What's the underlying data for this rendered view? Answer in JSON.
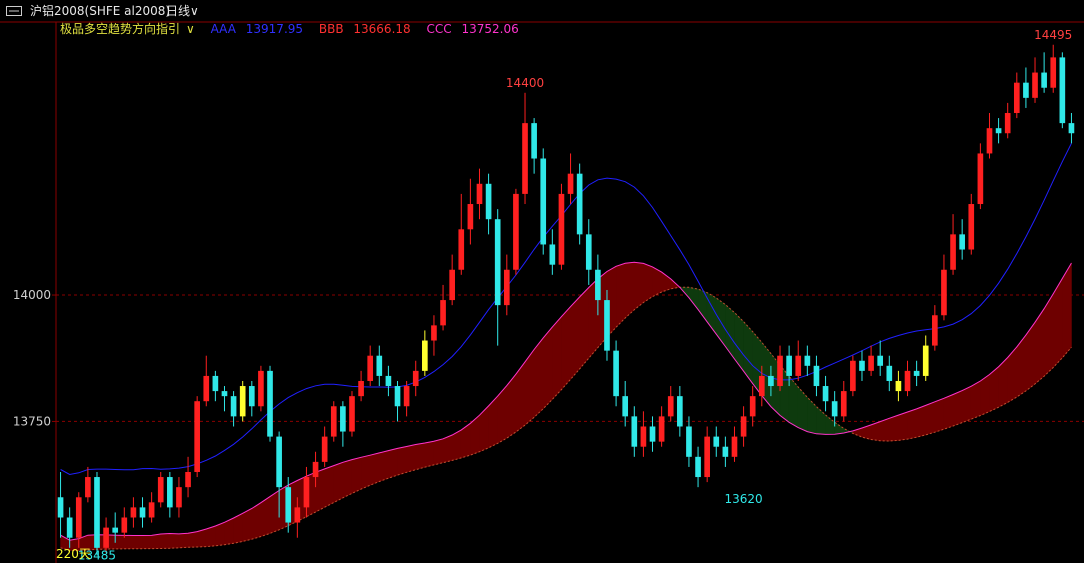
{
  "header": {
    "title": "沪铝2008(SHFE al2008)",
    "period": "日线",
    "period_caret": "∨"
  },
  "legend": {
    "indicator": "极品多空趋势方向指引",
    "caret": "∨",
    "items": [
      {
        "label": "AAA",
        "value": "13917.95",
        "color": "#2020ff"
      },
      {
        "label": "BBB",
        "value": "13666.18",
        "color": "#ff3030"
      },
      {
        "label": "CCC",
        "value": "13752.06",
        "color": "#ff33cc"
      }
    ]
  },
  "colors": {
    "up": "#ff2020",
    "down": "#30e8e8",
    "signal": "#ffff30",
    "aaa_line": "#2020ff",
    "ccc_line": "#ff33cc",
    "bull_band": "#6e0000",
    "bear_band": "#0e3a0e",
    "grid": "#8a0000",
    "axis": "#8a0000"
  },
  "chart_data": {
    "type": "candlestick",
    "ylim": [
      13470,
      14540
    ],
    "yticks": [
      {
        "value": 14000,
        "label": "14000"
      },
      {
        "value": 13750,
        "label": "13750"
      }
    ],
    "annotations": [
      {
        "text": "14400",
        "value": 14400,
        "index": 51,
        "color": "#ff4040"
      },
      {
        "text": "13620",
        "value": 13620,
        "index": 75,
        "color": "#30e8e8"
      },
      {
        "text": "14495",
        "value": 14495,
        "index": 109,
        "color": "#ff4040"
      },
      {
        "text": "13485",
        "value": 13485,
        "index": 4,
        "color": "#30e8e8"
      },
      {
        "text": "220天",
        "value": 13480,
        "index": 0,
        "color": "#ffff30"
      }
    ],
    "candles": [
      [
        13600,
        13560,
        13650,
        13520
      ],
      [
        13560,
        13520,
        13580,
        13500
      ],
      [
        13520,
        13600,
        13610,
        13500
      ],
      [
        13600,
        13640,
        13660,
        13590
      ],
      [
        13640,
        13500,
        13650,
        13485
      ],
      [
        13500,
        13540,
        13560,
        13490
      ],
      [
        13540,
        13530,
        13570,
        13510
      ],
      [
        13530,
        13560,
        13580,
        13520
      ],
      [
        13560,
        13580,
        13600,
        13540
      ],
      [
        13580,
        13560,
        13600,
        13540
      ],
      [
        13560,
        13590,
        13610,
        13550
      ],
      [
        13590,
        13640,
        13650,
        13580
      ],
      [
        13640,
        13580,
        13650,
        13560
      ],
      [
        13580,
        13620,
        13640,
        13560
      ],
      [
        13620,
        13650,
        13680,
        13600
      ],
      [
        13650,
        13790,
        13800,
        13640
      ],
      [
        13790,
        13840,
        13880,
        13780
      ],
      [
        13840,
        13810,
        13850,
        13790
      ],
      [
        13810,
        13800,
        13820,
        13770
      ],
      [
        13800,
        13760,
        13810,
        13740
      ],
      [
        13760,
        13820,
        13830,
        13750
      ],
      [
        13820,
        13780,
        13830,
        13760
      ],
      [
        13780,
        13850,
        13860,
        13770
      ],
      [
        13850,
        13720,
        13860,
        13710
      ],
      [
        13720,
        13620,
        13730,
        13560
      ],
      [
        13620,
        13550,
        13640,
        13530
      ],
      [
        13550,
        13580,
        13600,
        13520
      ],
      [
        13580,
        13640,
        13660,
        13560
      ],
      [
        13640,
        13670,
        13690,
        13620
      ],
      [
        13670,
        13720,
        13740,
        13660
      ],
      [
        13720,
        13780,
        13790,
        13710
      ],
      [
        13780,
        13730,
        13790,
        13700
      ],
      [
        13730,
        13800,
        13810,
        13720
      ],
      [
        13800,
        13830,
        13850,
        13790
      ],
      [
        13830,
        13880,
        13900,
        13820
      ],
      [
        13880,
        13840,
        13900,
        13820
      ],
      [
        13840,
        13820,
        13860,
        13800
      ],
      [
        13820,
        13780,
        13830,
        13750
      ],
      [
        13780,
        13820,
        13830,
        13760
      ],
      [
        13820,
        13850,
        13870,
        13800
      ],
      [
        13850,
        13910,
        13930,
        13840
      ],
      [
        13910,
        13940,
        13960,
        13880
      ],
      [
        13940,
        13990,
        14020,
        13930
      ],
      [
        13990,
        14050,
        14080,
        13980
      ],
      [
        14050,
        14130,
        14200,
        14040
      ],
      [
        14130,
        14180,
        14230,
        14100
      ],
      [
        14180,
        14220,
        14250,
        14150
      ],
      [
        14220,
        14150,
        14240,
        14120
      ],
      [
        14150,
        13980,
        14170,
        13900
      ],
      [
        13980,
        14050,
        14080,
        13960
      ],
      [
        14050,
        14200,
        14210,
        14040
      ],
      [
        14200,
        14340,
        14400,
        14180
      ],
      [
        14340,
        14270,
        14350,
        14240
      ],
      [
        14270,
        14100,
        14290,
        14080
      ],
      [
        14100,
        14060,
        14130,
        14040
      ],
      [
        14060,
        14200,
        14220,
        14050
      ],
      [
        14200,
        14240,
        14280,
        14180
      ],
      [
        14240,
        14120,
        14260,
        14100
      ],
      [
        14120,
        14050,
        14150,
        14020
      ],
      [
        14050,
        13990,
        14080,
        13960
      ],
      [
        13990,
        13890,
        14010,
        13870
      ],
      [
        13890,
        13800,
        13910,
        13780
      ],
      [
        13800,
        13760,
        13830,
        13740
      ],
      [
        13760,
        13700,
        13780,
        13680
      ],
      [
        13700,
        13740,
        13770,
        13680
      ],
      [
        13740,
        13710,
        13760,
        13690
      ],
      [
        13710,
        13760,
        13780,
        13700
      ],
      [
        13760,
        13800,
        13820,
        13750
      ],
      [
        13800,
        13740,
        13820,
        13720
      ],
      [
        13740,
        13680,
        13760,
        13660
      ],
      [
        13680,
        13640,
        13700,
        13620
      ],
      [
        13640,
        13720,
        13740,
        13630
      ],
      [
        13720,
        13700,
        13740,
        13680
      ],
      [
        13700,
        13680,
        13720,
        13660
      ],
      [
        13680,
        13720,
        13740,
        13670
      ],
      [
        13720,
        13760,
        13780,
        13700
      ],
      [
        13760,
        13800,
        13820,
        13740
      ],
      [
        13800,
        13840,
        13860,
        13780
      ],
      [
        13840,
        13820,
        13860,
        13800
      ],
      [
        13820,
        13880,
        13900,
        13810
      ],
      [
        13880,
        13840,
        13900,
        13820
      ],
      [
        13840,
        13880,
        13910,
        13830
      ],
      [
        13880,
        13860,
        13900,
        13840
      ],
      [
        13860,
        13820,
        13880,
        13800
      ],
      [
        13820,
        13790,
        13840,
        13770
      ],
      [
        13790,
        13760,
        13810,
        13740
      ],
      [
        13760,
        13810,
        13830,
        13750
      ],
      [
        13810,
        13870,
        13880,
        13800
      ],
      [
        13870,
        13850,
        13890,
        13830
      ],
      [
        13850,
        13880,
        13900,
        13840
      ],
      [
        13880,
        13860,
        13910,
        13840
      ],
      [
        13860,
        13830,
        13880,
        13810
      ],
      [
        13830,
        13810,
        13850,
        13790
      ],
      [
        13810,
        13850,
        13870,
        13800
      ],
      [
        13850,
        13840,
        13870,
        13820
      ],
      [
        13840,
        13900,
        13920,
        13830
      ],
      [
        13900,
        13960,
        13980,
        13890
      ],
      [
        13960,
        14050,
        14080,
        13950
      ],
      [
        14050,
        14120,
        14160,
        14040
      ],
      [
        14120,
        14090,
        14150,
        14070
      ],
      [
        14090,
        14180,
        14200,
        14080
      ],
      [
        14180,
        14280,
        14300,
        14170
      ],
      [
        14280,
        14330,
        14360,
        14270
      ],
      [
        14330,
        14320,
        14350,
        14300
      ],
      [
        14320,
        14360,
        14380,
        14310
      ],
      [
        14360,
        14420,
        14440,
        14350
      ],
      [
        14420,
        14390,
        14450,
        14370
      ],
      [
        14390,
        14440,
        14470,
        14380
      ],
      [
        14440,
        14410,
        14480,
        14400
      ],
      [
        14410,
        14470,
        14495,
        14400
      ],
      [
        14470,
        14340,
        14480,
        14330
      ],
      [
        14340,
        14320,
        14360,
        14300
      ]
    ]
  }
}
